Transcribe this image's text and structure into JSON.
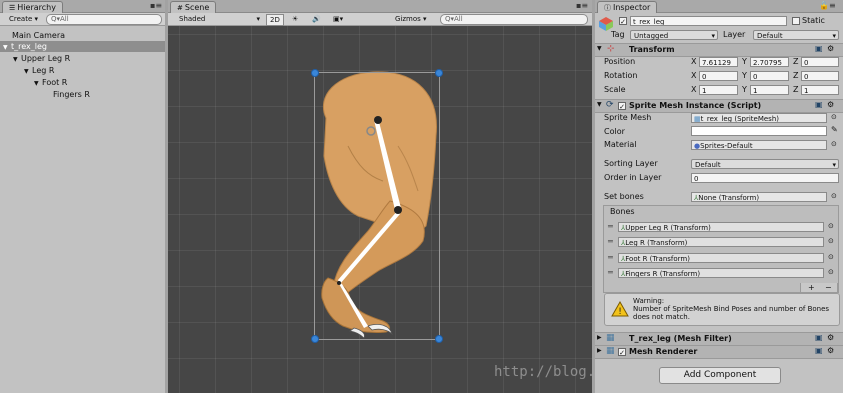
{
  "hierarchy": {
    "tab": "Hierarchy",
    "create": "Create ▾",
    "search_placeholder": "Q▾All",
    "items": [
      {
        "label": "Main Camera"
      },
      {
        "label": "t_rex_leg"
      },
      {
        "label": "Upper Leg R"
      },
      {
        "label": "Leg R"
      },
      {
        "label": "Foot R"
      },
      {
        "label": "Fingers R"
      }
    ]
  },
  "scene": {
    "tab": "Scene",
    "shading": "Shaded",
    "mode_2d": "2D",
    "gizmos": "Gizmos ▾",
    "search_placeholder": "Q▾All"
  },
  "inspector": {
    "tab": "Inspector",
    "object_name": "t_rex_leg",
    "static_label": "Static",
    "tag_label": "Tag",
    "tag_value": "Untagged",
    "layer_label": "Layer",
    "layer_value": "Default",
    "transform": {
      "title": "Transform",
      "position_label": "Position",
      "rotation_label": "Rotation",
      "scale_label": "Scale",
      "axis_x": "X",
      "axis_y": "Y",
      "axis_z": "Z",
      "position": {
        "x": "7.61129",
        "y": "2.70795",
        "z": "0"
      },
      "rotation": {
        "x": "0",
        "y": "0",
        "z": "0"
      },
      "scale": {
        "x": "1",
        "y": "1",
        "z": "1"
      }
    },
    "sprite_mesh": {
      "title": "Sprite Mesh Instance (Script)",
      "sprite_mesh_label": "Sprite Mesh",
      "sprite_mesh_value": "t_rex_leg (SpriteMesh)",
      "color_label": "Color",
      "material_label": "Material",
      "material_value": "Sprites-Default",
      "sorting_layer_label": "Sorting Layer",
      "sorting_layer_value": "Default",
      "order_label": "Order in Layer",
      "order_value": "0",
      "set_bones_label": "Set bones",
      "set_bones_value": "None (Transform)",
      "bones_header": "Bones",
      "bones": [
        {
          "label": "Upper Leg R (Transform)"
        },
        {
          "label": "Leg R (Transform)"
        },
        {
          "label": "Foot R (Transform)"
        },
        {
          "label": "Fingers R (Transform)"
        }
      ],
      "plus": "+",
      "minus": "−",
      "warning_title": "Warning:",
      "warning_line1": "Number of SpriteMesh Bind Poses and number of Bones",
      "warning_line2": "does not match."
    },
    "mesh_filter": {
      "title": "T_rex_leg (Mesh Filter)"
    },
    "mesh_renderer": {
      "title": "Mesh Renderer"
    },
    "add_component": "Add Component"
  },
  "watermark": "http://blog.csdn.net/..."
}
